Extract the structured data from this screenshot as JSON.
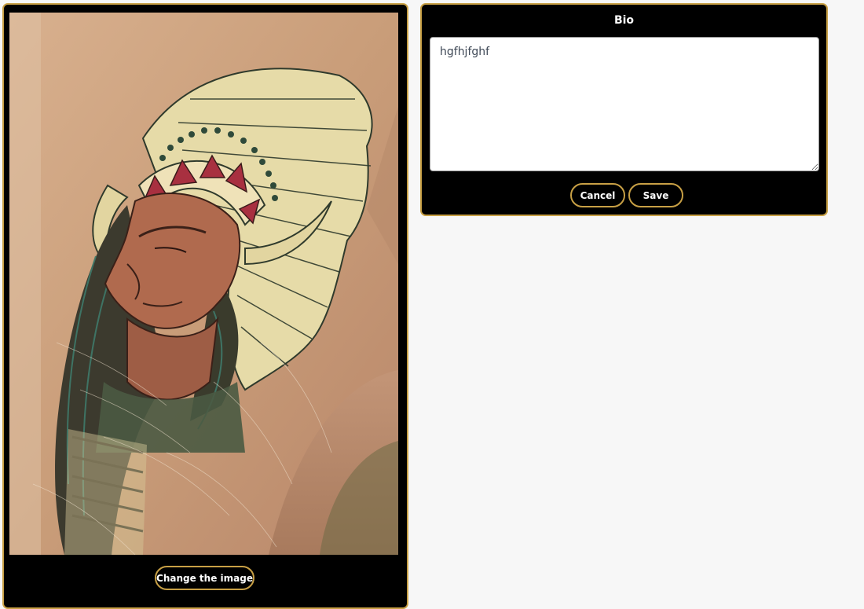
{
  "image_panel": {
    "photo_icon": "tattoo-photo",
    "change_button_label": "Change the image"
  },
  "bio_panel": {
    "title": "Bio",
    "bio_value": "hgfhjfghf",
    "cancel_label": "Cancel",
    "save_label": "Save"
  },
  "colors": {
    "accent_border": "#c8a045",
    "panel_background": "#000000",
    "page_background": "#f7f7f7"
  }
}
